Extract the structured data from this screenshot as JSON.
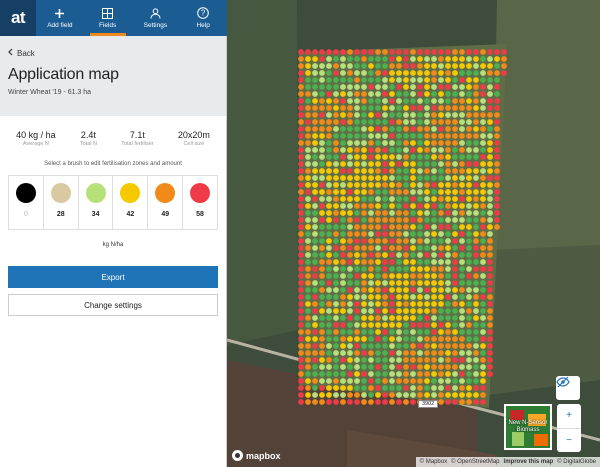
{
  "nav": {
    "logo": "at",
    "items": [
      {
        "label": "Add field",
        "icon": "plus-icon"
      },
      {
        "label": "Fields",
        "icon": "fields-icon",
        "active": true
      },
      {
        "label": "Settings",
        "icon": "person-icon"
      },
      {
        "label": "Help",
        "icon": "question-icon"
      }
    ]
  },
  "sidebar": {
    "back_label": "Back",
    "title": "Application map",
    "subtitle": "Winter Wheat '19 - 61.3 ha",
    "stats": [
      {
        "value": "40 kg / ha",
        "label": "Average N"
      },
      {
        "value": "2.4t",
        "label": "Total N"
      },
      {
        "value": "7.1t",
        "label": "Total fertiliser"
      },
      {
        "value": "20x20m",
        "label": "Cell size"
      }
    ],
    "brush_hint": "Select a brush to edit fertilisation zones and amount",
    "swatches": [
      {
        "value": "0",
        "color": "#000000"
      },
      {
        "value": "28",
        "color": "#d9c9a0"
      },
      {
        "value": "34",
        "color": "#b8e07a"
      },
      {
        "value": "42",
        "color": "#f5c800"
      },
      {
        "value": "49",
        "color": "#f28a1a"
      },
      {
        "value": "58",
        "color": "#ef3b47"
      }
    ],
    "units": "kg N/ha",
    "export_label": "Export",
    "change_settings_label": "Change settings"
  },
  "map": {
    "road_label": "3902",
    "thumbnail_label": "New N-Sensor Biomass",
    "zoom_in": "+",
    "zoom_out": "−",
    "mapbox_label": "mapbox",
    "attribution": {
      "mapbox": "© Mapbox",
      "osm": "© OpenStreetMap",
      "improve": "Improve this map",
      "digitalglobe": "© DigitalGlobe"
    }
  }
}
